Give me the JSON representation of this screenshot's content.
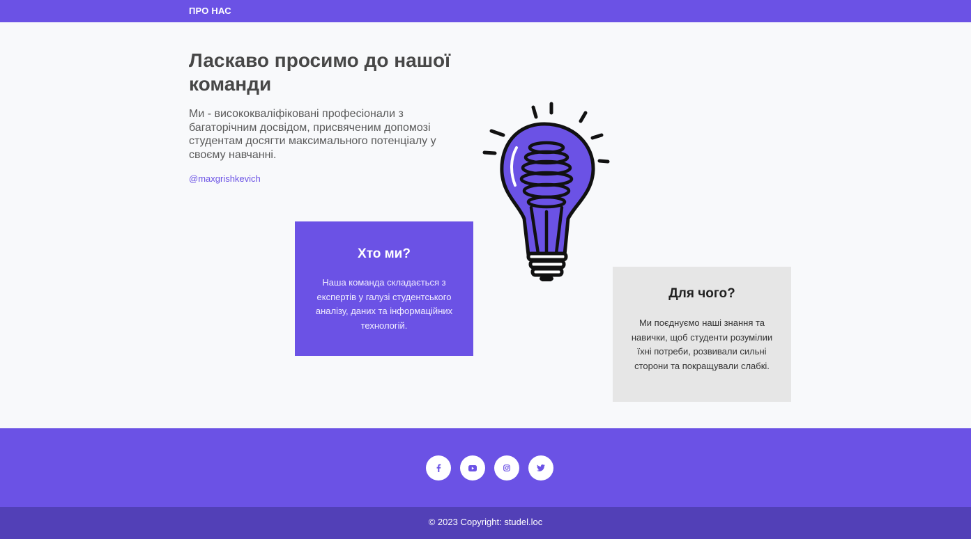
{
  "nav": {
    "title": "ПРО НАС"
  },
  "hero": {
    "heading": "Ласкаво просимо до нашої команди",
    "intro": "Ми - висококваліфіковані професіонали з багаторічним досвідом, присвяченим допомозі студентам досягти максимального потенціалу у своєму навчанні.",
    "handle": "@maxgrishkevich",
    "illustration_icon": "lightbulb-icon"
  },
  "cards": {
    "who": {
      "title": "Хто ми?",
      "text": "Наша команда складається з експертів у галузі студентського аналізу, даних та інформаційних технологій."
    },
    "why": {
      "title": "Для чого?",
      "text": "Ми поєднуємо наші знання та навички, щоб студенти розумілии їхні потреби, розвивали сильні сторони та покращували слабкі."
    }
  },
  "footer": {
    "socials": [
      "facebook-icon",
      "youtube-icon",
      "instagram-icon",
      "twitter-icon"
    ],
    "copyright": "© 2023 Copyright: studel.loc"
  },
  "colors": {
    "accent": "#6b52e5",
    "accent_dark": "#5240b7",
    "card_gray": "#e6e6e6",
    "background": "#f8f9fb"
  }
}
